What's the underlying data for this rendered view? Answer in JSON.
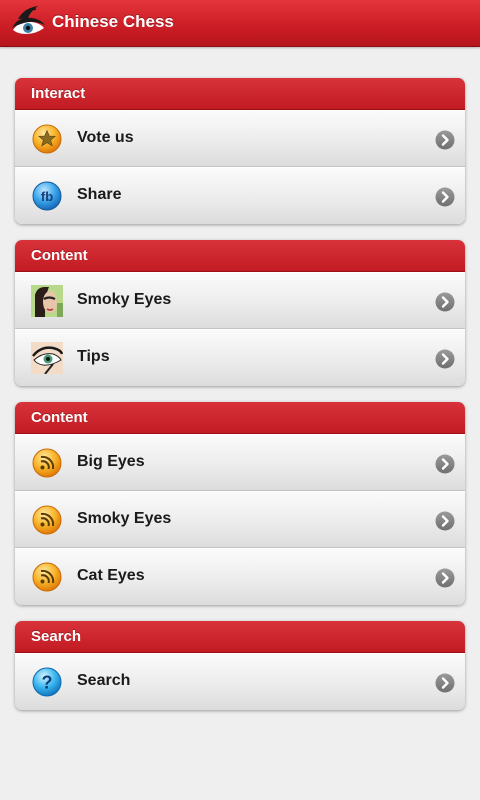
{
  "app": {
    "title": "Chinese Chess"
  },
  "colors": {
    "brand_red": "#cc1e26",
    "background": "#efefef",
    "rss_orange": "#f7a21a",
    "help_blue": "#1e9be0"
  },
  "sections": [
    {
      "title": "Interact",
      "items": [
        {
          "label": "Vote us",
          "icon": "star-icon"
        },
        {
          "label": "Share",
          "icon": "facebook-icon"
        }
      ]
    },
    {
      "title": "Content",
      "items": [
        {
          "label": "Smoky Eyes",
          "icon": "smoky-eyes-thumbnail-icon"
        },
        {
          "label": "Tips",
          "icon": "eye-thumbnail-icon"
        }
      ]
    },
    {
      "title": "Content",
      "items": [
        {
          "label": "Big Eyes",
          "icon": "rss-icon"
        },
        {
          "label": "Smoky Eyes",
          "icon": "rss-icon"
        },
        {
          "label": "Cat Eyes",
          "icon": "rss-icon"
        }
      ]
    },
    {
      "title": "Search",
      "items": [
        {
          "label": "Search",
          "icon": "help-icon"
        }
      ]
    }
  ]
}
